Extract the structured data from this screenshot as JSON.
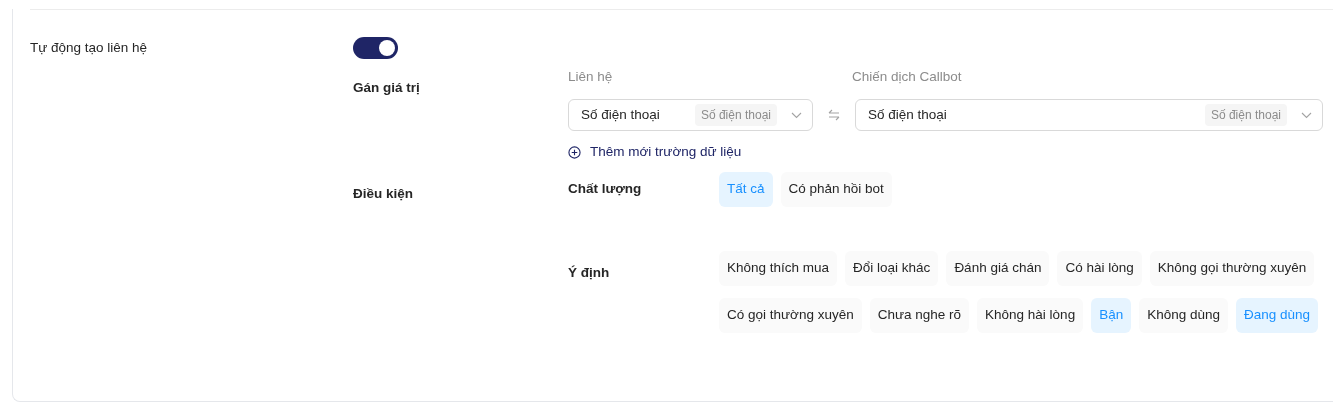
{
  "auto_create": {
    "label": "Tự động tạo liên hệ",
    "on": true
  },
  "assign": {
    "label": "Gán giá trị",
    "left_heading": "Liên hệ",
    "right_heading": "Chiến dịch Callbot",
    "left_select": {
      "value": "Số điện thoại",
      "tag": "Số điện thoại"
    },
    "right_select": {
      "value": "Số điện thoại",
      "tag": "Số điện thoại"
    },
    "add_field": "Thêm mới trường dữ liệu"
  },
  "conditions": {
    "label": "Điều kiện",
    "groups": [
      {
        "label": "Chất lượng",
        "options": [
          {
            "label": "Tất cả",
            "selected": true
          },
          {
            "label": "Có phản hồi bot",
            "selected": false
          }
        ]
      },
      {
        "label": "Ý định",
        "options": [
          {
            "label": "Không thích mua",
            "selected": false
          },
          {
            "label": "Đổi loại khác",
            "selected": false
          },
          {
            "label": "Đánh giá chán",
            "selected": false
          },
          {
            "label": "Có hài lòng",
            "selected": false
          },
          {
            "label": "Không gọi thường xuyên",
            "selected": false
          },
          {
            "label": "Có gọi thường xuyên",
            "selected": false
          },
          {
            "label": "Chưa nghe rõ",
            "selected": false
          },
          {
            "label": "Không hài lòng",
            "selected": false
          },
          {
            "label": "Bận",
            "selected": true
          },
          {
            "label": "Không dùng",
            "selected": false
          },
          {
            "label": "Đang dùng",
            "selected": true
          }
        ]
      }
    ]
  }
}
